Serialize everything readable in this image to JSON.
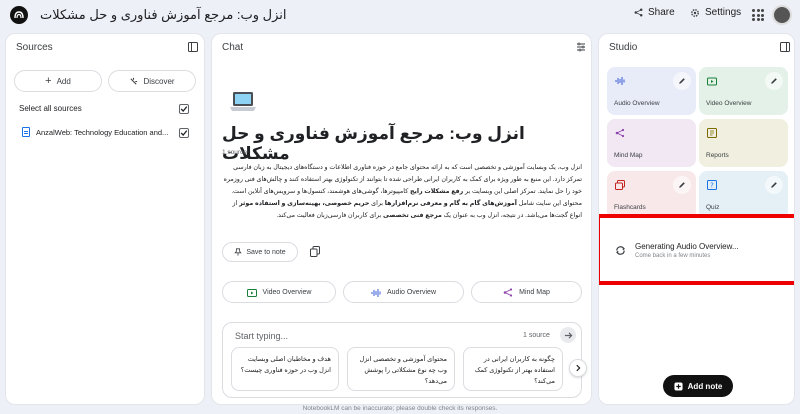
{
  "notebook_title": "انزل وب: مرجع آموزش فناوری و حل مشکلات",
  "header": {
    "share_label": "Share",
    "settings_label": "Settings"
  },
  "sources": {
    "title": "Sources",
    "add_label": "Add",
    "discover_label": "Discover",
    "select_all_label": "Select all sources",
    "items": [
      {
        "label": "AnzalWeb: Technology Education and..."
      }
    ]
  },
  "chat": {
    "title": "Chat",
    "source_title": "انزل وب: مرجع آموزش فناوری و حل مشکلات",
    "source_count": "1 source",
    "summary": {
      "p1": "انزل وب، یک وبسایت آموزشی و تخصصی است که به ارائه محتوای جامع در حوزه فناوری اطلاعات و دستگاه‌های دیجیتال به زبان فارسی",
      "p2": "تمرکز دارد. این منبع به طور ویژه برای کمک به کاربران ایرانی طراحی شده تا بتوانند از تکنولوژی بهتر استفاده کنند و چالش‌های فنی روزمره",
      "p3": "خود را حل نمایند. تمرکز اصلی این وبسایت بر",
      "b1": "رفع مشکلات رایج",
      "p4": "کامپیوترها، گوشی‌های هوشمند، کنسول‌ها و سرویس‌های آنلاین است.",
      "p5": "محتوای این سایت شامل",
      "b2": "آموزش‌های گام به گام و معرفی نرم‌افزارها",
      "p6": "برای",
      "b3": "حریم خصوصی، بهینه‌سازی و استفاده موثر",
      "p7": "از انواع گجت‌ها می‌باشد. در",
      "p8": "نتیجه، انزل وب به عنوان یک",
      "b4": "مرجع فنی تخصصی",
      "p9": "برای کاربران فارسی‌زبان فعالیت می‌کند."
    },
    "save_note_label": "Save to note",
    "actions": {
      "video_overview": "Video Overview",
      "audio_overview": "Audio Overview",
      "mind_map": "Mind Map"
    },
    "composer": {
      "placeholder": "Start typing...",
      "source_count": "1 source"
    },
    "suggestions": [
      "هدف و مخاطبان اصلی وبسایت انزل وب در حوزه فناوری چیست؟",
      "محتوای آموزشی و تخصصی انزل وب چه نوع مشکلاتی را پوشش می‌دهد؟",
      "چگونه به کاربران ایرانی در استفاده بهتر از تکنولوژی کمک می‌کند؟"
    ]
  },
  "studio": {
    "title": "Studio",
    "tiles": {
      "audio_overview": "Audio Overview",
      "video_overview": "Video Overview",
      "mind_map": "Mind Map",
      "reports": "Reports",
      "flashcards": "Flashcards",
      "quiz": "Quiz"
    },
    "generating": {
      "title": "Generating Audio Overview...",
      "subtitle": "Come back in a few minutes"
    },
    "add_note_label": "Add note"
  },
  "disclaimer": "NotebookLM can be inaccurate; please double check its responses.",
  "colors": {
    "background": "#eef0f7",
    "audio_tile": "#e8ebf8",
    "video_tile": "#e4f1e8",
    "mindmap_tile": "#f1e8f3",
    "reports_tile": "#f1f0e0",
    "flashcards_tile": "#f8e8ea",
    "quiz_tile": "#e4eff6",
    "highlight_border": "#ee0000"
  }
}
